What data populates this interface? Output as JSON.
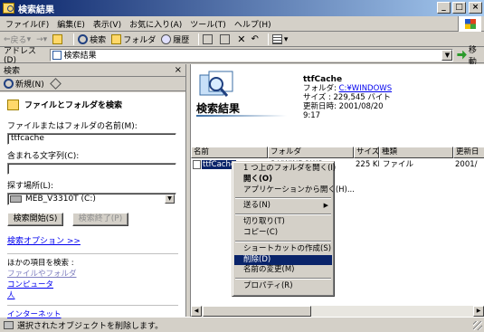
{
  "window": {
    "title": "検索結果"
  },
  "titlebar_buttons": {
    "minimize": "_",
    "maximize": "□",
    "close": "×"
  },
  "menu": [
    "ファイル(F)",
    "編集(E)",
    "表示(V)",
    "お気に入り(A)",
    "ツール(T)",
    "ヘルプ(H)"
  ],
  "toolbar": {
    "back": "戻る",
    "forward": "→",
    "search": "検索",
    "folders": "フォルダ",
    "history": "履歴"
  },
  "address": {
    "label": "アドレス(D)",
    "value": "検索結果",
    "go": "移動"
  },
  "search_pane": {
    "header": "検索",
    "close": "×",
    "new": "新規(N)",
    "section_title": "ファイルとフォルダを検索",
    "name_label": "ファイルまたはフォルダの名前(M):",
    "name_value": "ttfcache",
    "text_label": "含まれる文字列(C):",
    "text_value": "",
    "lookin_label": "探す場所(L):",
    "lookin_value": "MEB_V3310T (C:)",
    "start_button": "検索開始(S)",
    "stop_button": "検索終了(P)",
    "options_link": "検索オプション >>",
    "other_label": "ほかの項目を検索 :",
    "other_links": [
      "ファイルやフォルダ",
      "コンピュータ",
      "人"
    ],
    "internet_link": "インターネット"
  },
  "results": {
    "banner_title": "検索結果",
    "info": {
      "name": "ttfCache",
      "folder_label": "フォルダ:",
      "folder_value": "C:¥WINDOWS",
      "size": "サイズ : 229,545 バイト",
      "modified_label": "更新日時:",
      "modified_value": "2001/08/20",
      "modified_time": "9:17"
    },
    "columns": [
      "名前",
      "フォルダ",
      "サイズ",
      "種類",
      "更新日"
    ],
    "row": {
      "name": "ttfCache",
      "folder": "C:¥WINDOWS",
      "size": "225 KB",
      "type": "ファイル",
      "modified": "2001/"
    }
  },
  "context_menu": [
    {
      "label": "1 つ上のフォルダを開く(I)"
    },
    {
      "label": "開く(O)",
      "bold": true
    },
    {
      "label": "アプリケーションから開く(H)..."
    },
    {
      "sep": true
    },
    {
      "label": "送る(N)",
      "submenu": true
    },
    {
      "sep": true
    },
    {
      "label": "切り取り(T)"
    },
    {
      "label": "コピー(C)"
    },
    {
      "sep": true
    },
    {
      "label": "ショートカットの作成(S)"
    },
    {
      "label": "削除(D)",
      "highlighted": true
    },
    {
      "label": "名前の変更(M)"
    },
    {
      "sep": true
    },
    {
      "label": "プロパティ(R)"
    }
  ],
  "status": {
    "text": "選択されたオブジェクトを削除します。"
  }
}
